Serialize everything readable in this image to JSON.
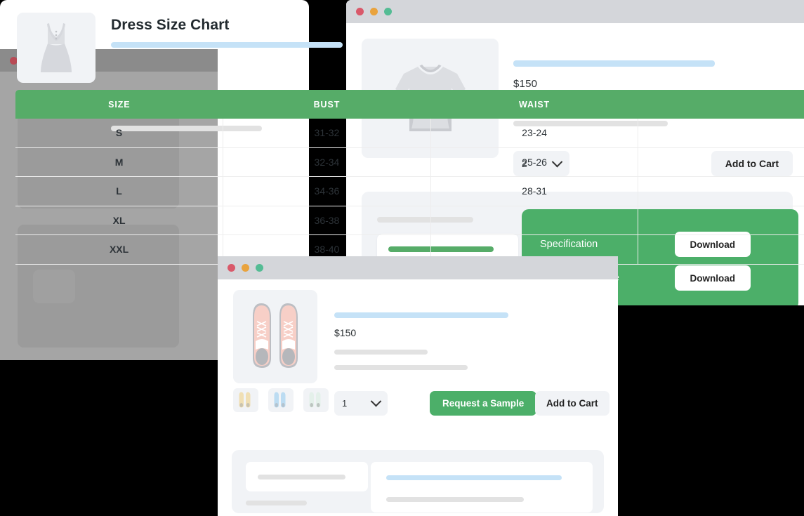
{
  "windowA": {
    "traffic_lights": [
      "close",
      "minimize",
      "maximize"
    ],
    "price": "$150",
    "quantity": "2",
    "add_to_cart_label": "Add to Cart",
    "downloads": [
      {
        "label": "Specification",
        "button_label": "Download"
      },
      {
        "label": "Product Brochure",
        "button_label": "Download"
      }
    ],
    "product_image": "tshirt-illustration",
    "accent_green": "#4caf69"
  },
  "windowB": {
    "state": "dimmed-background-window",
    "traffic_lights": [
      "close",
      "minimize",
      "maximize"
    ]
  },
  "modal": {
    "title": "Dress Size Chart",
    "product_image": "dress-illustration",
    "table": {
      "headers": [
        "SIZE",
        "BUST",
        "WAIST",
        ""
      ],
      "rows": [
        [
          "S",
          "31-32",
          "23-24",
          ""
        ],
        [
          "M",
          "32-34",
          "25-26",
          ""
        ],
        [
          "L",
          "34-36",
          "28-31",
          ""
        ],
        [
          "XL",
          "36-38",
          "",
          ""
        ],
        [
          "XXL",
          "38-40",
          "",
          ""
        ]
      ]
    },
    "header_green": "#56ac68"
  },
  "windowD": {
    "traffic_lights": [
      "close",
      "minimize",
      "maximize"
    ],
    "price": "$150",
    "quantity": "1",
    "request_sample_label": "Request a Sample",
    "add_to_cart_label": "Add to Cart",
    "product_image": "sneakers-pink-illustration",
    "thumbnails": [
      "sneakers-yellow",
      "sneakers-blue",
      "sneakers-mint"
    ]
  }
}
